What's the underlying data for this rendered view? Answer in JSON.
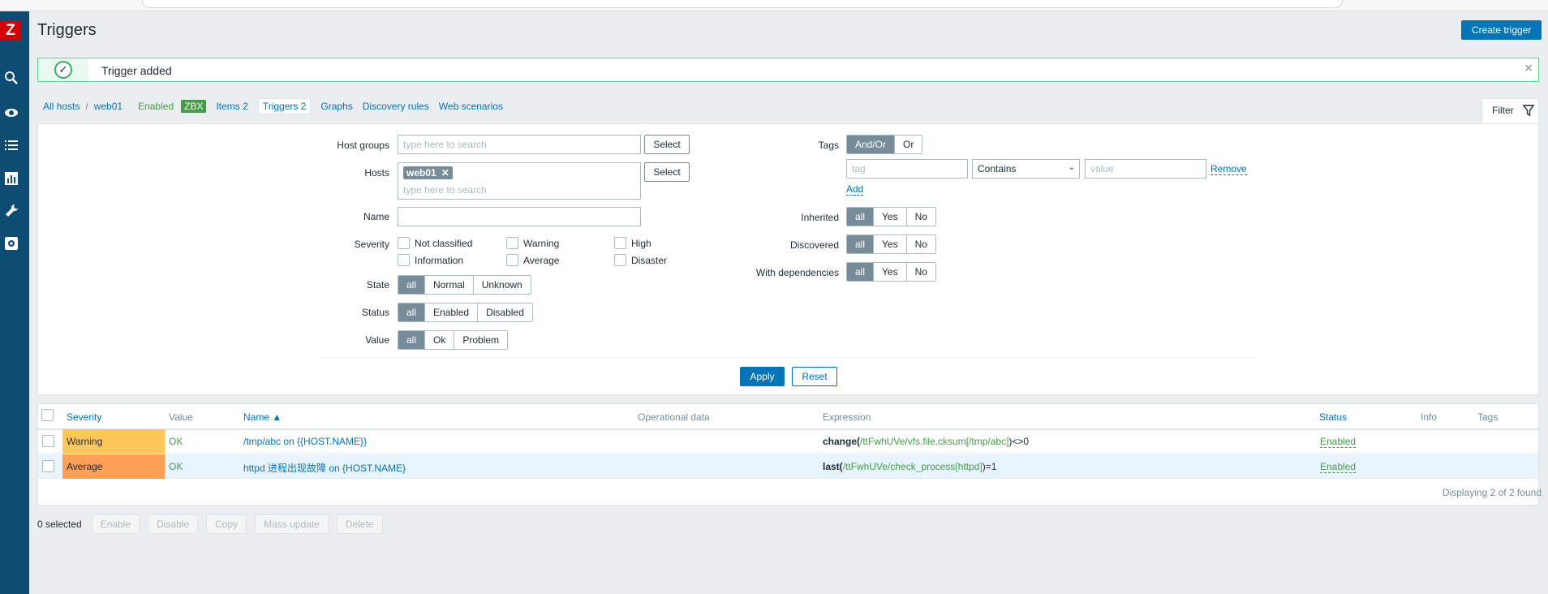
{
  "page": {
    "title": "Triggers",
    "create_button": "Create trigger"
  },
  "message": {
    "text": "Trigger added",
    "close": "×"
  },
  "sidebar": {
    "logo": "Z",
    "icons": [
      "search-icon",
      "eye-icon",
      "list-icon",
      "chart-icon",
      "wrench-icon",
      "gear-icon"
    ]
  },
  "nav": {
    "all_hosts": "All hosts",
    "separator": "/",
    "host": "web01",
    "enabled": "Enabled",
    "badge": "ZBX",
    "items": "Items 2",
    "triggers": "Triggers 2",
    "graphs": "Graphs",
    "discovery": "Discovery rules",
    "web": "Web scenarios"
  },
  "filter": {
    "tab_label": "Filter",
    "host_groups_label": "Host groups",
    "host_groups_placeholder": "type here to search",
    "select": "Select",
    "hosts_label": "Hosts",
    "hosts_token": "web01",
    "hosts_token_remove": "✕",
    "hosts_placeholder": "type here to search",
    "name_label": "Name",
    "name_value": "",
    "severity_label": "Severity",
    "severities": [
      "Not classified",
      "Warning",
      "High",
      "Information",
      "Average",
      "Disaster"
    ],
    "state_label": "State",
    "state_options": [
      "all",
      "Normal",
      "Unknown"
    ],
    "status_label": "Status",
    "status_options": [
      "all",
      "Enabled",
      "Disabled"
    ],
    "value_label": "Value",
    "value_options": [
      "all",
      "Ok",
      "Problem"
    ],
    "tags_label": "Tags",
    "tags_options": [
      "And/Or",
      "Or"
    ],
    "tag_placeholder": "tag",
    "operator": "Contains",
    "value_placeholder": "value",
    "remove": "Remove",
    "add": "Add",
    "inherited_label": "Inherited",
    "discovered_label": "Discovered",
    "dependencies_label": "With dependencies",
    "tri_options": [
      "all",
      "Yes",
      "No"
    ],
    "apply": "Apply",
    "reset": "Reset"
  },
  "table": {
    "headers": {
      "severity": "Severity",
      "value": "Value",
      "name": "Name ▲",
      "opdata": "Operational data",
      "expression": "Expression",
      "status": "Status",
      "info": "Info",
      "tags": "Tags"
    },
    "rows": [
      {
        "severity": "Warning",
        "severity_color": "#ffc859",
        "value": "OK",
        "name": "/tmp/abc on {{HOST.NAME}}",
        "expr_func": "change(",
        "expr_host": "/ttFwhUVe/vfs.file.cksum[/tmp/abc]",
        "expr_tail": ")<>0",
        "status": "Enabled"
      },
      {
        "severity": "Average",
        "severity_color": "#ffa059",
        "value": "OK",
        "name": "httpd 进程出现故障 on {HOST.NAME}",
        "expr_func": "last(",
        "expr_host": "/ttFwhUVe/check_process[httpd]",
        "expr_tail": ")=1",
        "status": "Enabled"
      }
    ],
    "displaying": "Displaying 2 of 2 found"
  },
  "actions": {
    "selected": "0 selected",
    "buttons": [
      "Enable",
      "Disable",
      "Copy",
      "Mass update",
      "Delete"
    ]
  }
}
